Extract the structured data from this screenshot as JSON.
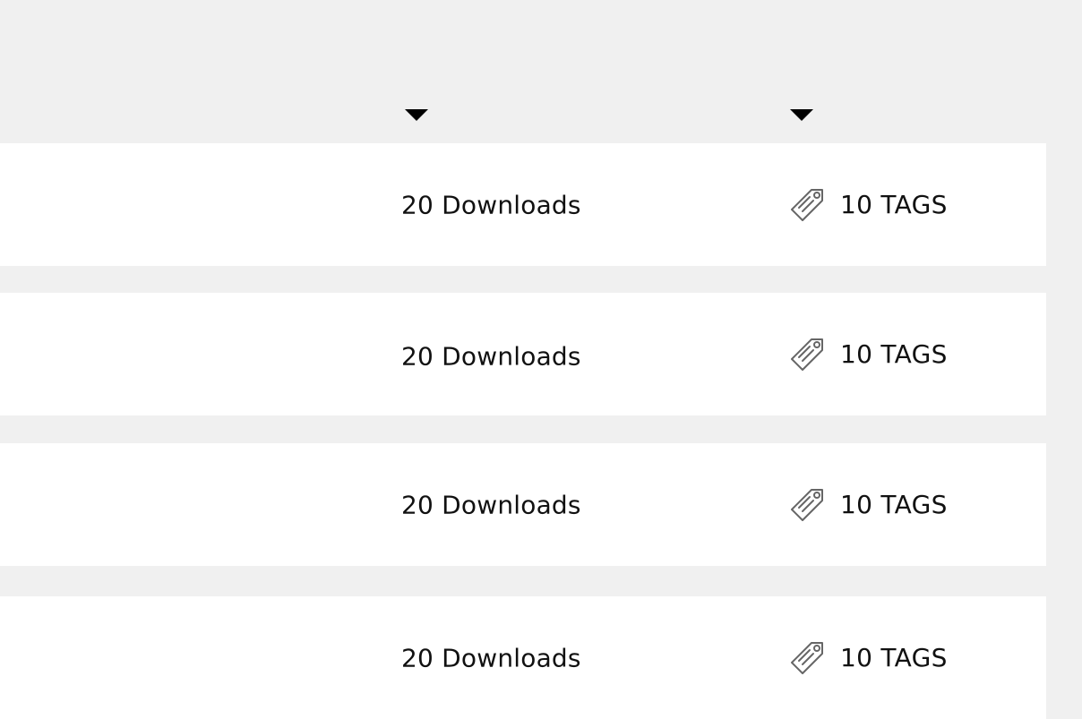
{
  "columns": {
    "downloads_sort_icon": "triangle-down",
    "tags_sort_icon": "triangle-down"
  },
  "rows": [
    {
      "downloads": "20 Downloads",
      "tags": "10 TAGS",
      "tag_icon": "tag-icon"
    },
    {
      "downloads": "20 Downloads",
      "tags": "10 TAGS",
      "tag_icon": "tag-icon"
    },
    {
      "downloads": "20 Downloads",
      "tags": "10 TAGS",
      "tag_icon": "tag-icon"
    },
    {
      "downloads": "20 Downloads",
      "tags": "10 TAGS",
      "tag_icon": "tag-icon"
    }
  ],
  "colors": {
    "page_background": "#f0f0f0",
    "row_background": "#ffffff",
    "text": "#111111",
    "icon": "#666666"
  }
}
